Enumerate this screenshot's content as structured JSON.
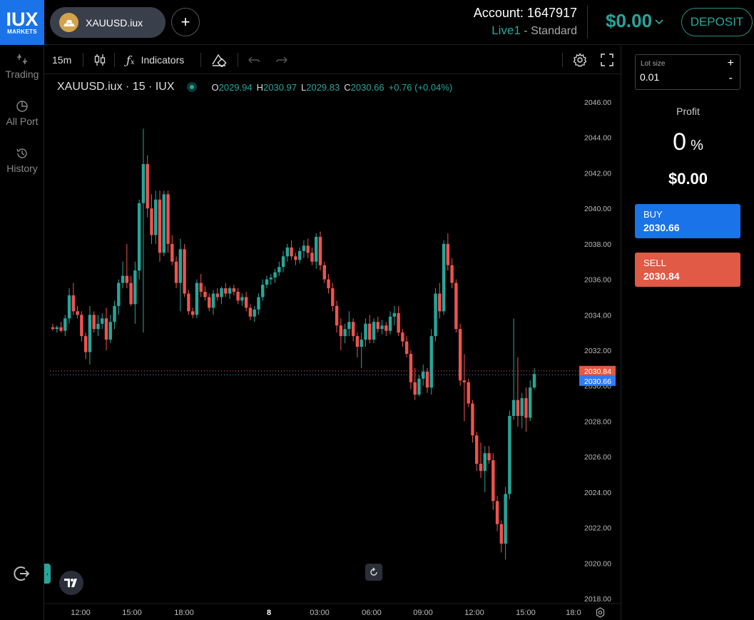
{
  "logo": {
    "main": "IUX",
    "sub": "MARKETS"
  },
  "symbol_pill": {
    "label": "XAUUSD.iux",
    "icon": "gold-bars-icon"
  },
  "add_symbol": {
    "label": "+"
  },
  "account": {
    "label": "Account:",
    "number": "1647917",
    "type": "Live1",
    "separator": " - ",
    "plan": "Standard"
  },
  "balance": {
    "value": "$0.00"
  },
  "deposit": {
    "label": "DEPOSIT"
  },
  "nav": {
    "items": [
      {
        "label": "Trading",
        "icon": "scale-icon"
      },
      {
        "label": "All Port",
        "icon": "pie-chart-icon"
      },
      {
        "label": "History",
        "icon": "history-icon"
      }
    ],
    "logout_icon": "logout-icon"
  },
  "toolbar": {
    "interval": "15m",
    "indicators": "Indicators"
  },
  "legend": {
    "title": "XAUUSD.iux · 15 · IUX",
    "o_key": "O",
    "o_val": "2029.94",
    "h_key": "H",
    "h_val": "2030.97",
    "l_key": "L",
    "l_val": "2029.83",
    "c_key": "C",
    "c_val": "2030.66",
    "change": "+0.76 (+0.04%)"
  },
  "colors": {
    "up": "#26a69a",
    "down": "#ef5350",
    "buy": "#1a73e8",
    "sell": "#e05a45"
  },
  "chart_data": {
    "type": "candlestick",
    "y_ticks": [
      "2046.00",
      "2044.00",
      "2042.00",
      "2040.00",
      "2038.00",
      "2036.00",
      "2034.00",
      "2032.00",
      "2030.00",
      "2028.00",
      "2026.00",
      "2024.00",
      "2022.00",
      "2020.00",
      "2018.00"
    ],
    "ylim": [
      2018,
      2046
    ],
    "x_ticks": [
      "12:00",
      "15:00",
      "18:00",
      "8",
      "03:00",
      "06:00",
      "09:00",
      "12:00",
      "15:00",
      "18:0"
    ],
    "ask_line": {
      "label": "2030.84",
      "value": 2030.84
    },
    "bid_line": {
      "label": "2030.66",
      "value": 2030.66
    },
    "candles": [
      [
        2033.3,
        2033.5,
        2033.1,
        2033.2
      ],
      [
        2033.2,
        2033.4,
        2033.0,
        2033.3
      ],
      [
        2033.3,
        2033.6,
        2033.0,
        2033.1
      ],
      [
        2033.1,
        2034.0,
        2032.8,
        2033.8
      ],
      [
        2033.8,
        2035.5,
        2033.5,
        2035.1
      ],
      [
        2035.1,
        2035.8,
        2034.0,
        2034.2
      ],
      [
        2034.2,
        2034.5,
        2033.8,
        2034.0
      ],
      [
        2034.0,
        2034.2,
        2032.5,
        2032.8
      ],
      [
        2032.8,
        2033.0,
        2031.5,
        2031.9
      ],
      [
        2031.9,
        2034.5,
        2031.2,
        2034.0
      ],
      [
        2034.0,
        2034.2,
        2033.0,
        2033.2
      ],
      [
        2033.2,
        2034.0,
        2032.8,
        2033.5
      ],
      [
        2033.5,
        2034.1,
        2033.2,
        2033.8
      ],
      [
        2033.8,
        2034.4,
        2032.0,
        2032.6
      ],
      [
        2032.6,
        2034.0,
        2032.4,
        2033.6
      ],
      [
        2033.6,
        2034.8,
        2033.2,
        2034.5
      ],
      [
        2034.5,
        2036.0,
        2034.0,
        2035.8
      ],
      [
        2035.8,
        2037.0,
        2035.5,
        2036.2
      ],
      [
        2036.2,
        2038.0,
        2035.5,
        2035.8
      ],
      [
        2035.8,
        2036.2,
        2034.5,
        2034.6
      ],
      [
        2034.6,
        2037.0,
        2033.5,
        2036.5
      ],
      [
        2036.5,
        2040.5,
        2036.0,
        2040.3
      ],
      [
        2040.3,
        2044.5,
        2033.0,
        2042.5
      ],
      [
        2042.5,
        2043.0,
        2039.5,
        2040.0
      ],
      [
        2040.0,
        2040.8,
        2038.0,
        2038.5
      ],
      [
        2038.5,
        2041.0,
        2038.0,
        2040.5
      ],
      [
        2040.5,
        2041.0,
        2037.0,
        2037.5
      ],
      [
        2037.5,
        2041.0,
        2037.3,
        2040.8
      ],
      [
        2040.8,
        2041.0,
        2037.5,
        2038.0
      ],
      [
        2038.0,
        2038.5,
        2036.8,
        2037.0
      ],
      [
        2037.0,
        2037.3,
        2035.5,
        2035.8
      ],
      [
        2035.8,
        2038.3,
        2034.2,
        2037.7
      ],
      [
        2037.7,
        2038.0,
        2035.0,
        2035.2
      ],
      [
        2035.2,
        2035.4,
        2034.0,
        2034.2
      ],
      [
        2034.2,
        2034.4,
        2033.8,
        2034.0
      ],
      [
        2034.0,
        2036.0,
        2033.8,
        2035.8
      ],
      [
        2035.8,
        2036.3,
        2035.0,
        2035.3
      ],
      [
        2035.3,
        2035.6,
        2034.8,
        2035.0
      ],
      [
        2035.0,
        2035.2,
        2034.2,
        2034.4
      ],
      [
        2034.4,
        2035.4,
        2034.0,
        2035.2
      ],
      [
        2035.2,
        2035.5,
        2034.8,
        2035.0
      ],
      [
        2035.0,
        2035.6,
        2034.6,
        2035.5
      ],
      [
        2035.5,
        2035.8,
        2035.0,
        2035.2
      ],
      [
        2035.2,
        2035.6,
        2034.9,
        2035.5
      ],
      [
        2035.5,
        2035.7,
        2035.1,
        2035.3
      ],
      [
        2035.3,
        2035.5,
        2034.6,
        2034.8
      ],
      [
        2034.8,
        2035.2,
        2034.5,
        2035.0
      ],
      [
        2035.0,
        2035.3,
        2034.2,
        2034.4
      ],
      [
        2034.4,
        2034.6,
        2033.7,
        2033.9
      ],
      [
        2033.9,
        2034.5,
        2033.6,
        2034.3
      ],
      [
        2034.3,
        2035.2,
        2034.0,
        2035.0
      ],
      [
        2035.0,
        2036.0,
        2034.8,
        2035.7
      ],
      [
        2035.7,
        2036.2,
        2035.5,
        2036.0
      ],
      [
        2036.0,
        2036.3,
        2035.7,
        2036.1
      ],
      [
        2036.1,
        2036.6,
        2035.8,
        2036.4
      ],
      [
        2036.4,
        2037.0,
        2036.2,
        2036.7
      ],
      [
        2036.7,
        2037.6,
        2036.4,
        2037.3
      ],
      [
        2037.3,
        2038.0,
        2037.0,
        2037.8
      ],
      [
        2037.8,
        2038.2,
        2037.1,
        2037.3
      ],
      [
        2037.3,
        2037.5,
        2036.8,
        2037.1
      ],
      [
        2037.1,
        2037.8,
        2036.9,
        2037.6
      ],
      [
        2037.6,
        2038.2,
        2037.2,
        2037.9
      ],
      [
        2037.9,
        2038.3,
        2037.2,
        2037.5
      ],
      [
        2037.5,
        2037.8,
        2036.8,
        2037.0
      ],
      [
        2037.0,
        2038.6,
        2036.6,
        2038.4
      ],
      [
        2038.4,
        2038.7,
        2036.5,
        2036.8
      ],
      [
        2036.8,
        2037.0,
        2035.8,
        2036.0
      ],
      [
        2036.0,
        2036.3,
        2035.2,
        2035.5
      ],
      [
        2035.5,
        2035.8,
        2034.2,
        2034.5
      ],
      [
        2034.5,
        2034.8,
        2033.0,
        2033.4
      ],
      [
        2033.4,
        2033.8,
        2032.0,
        2032.8
      ],
      [
        2032.8,
        2033.5,
        2032.4,
        2033.2
      ],
      [
        2033.2,
        2034.2,
        2032.8,
        2033.6
      ],
      [
        2033.6,
        2033.8,
        2032.5,
        2032.8
      ],
      [
        2032.8,
        2033.0,
        2031.6,
        2032.2
      ],
      [
        2032.2,
        2033.0,
        2031.0,
        2032.6
      ],
      [
        2032.6,
        2033.8,
        2032.2,
        2033.5
      ],
      [
        2033.5,
        2034.0,
        2032.4,
        2032.6
      ],
      [
        2032.6,
        2033.8,
        2032.4,
        2033.6
      ],
      [
        2033.6,
        2033.9,
        2033.0,
        2033.2
      ],
      [
        2033.2,
        2033.7,
        2032.9,
        2033.4
      ],
      [
        2033.4,
        2033.6,
        2032.8,
        2033.1
      ],
      [
        2033.1,
        2034.2,
        2032.9,
        2033.9
      ],
      [
        2033.9,
        2034.5,
        2033.4,
        2034.1
      ],
      [
        2034.1,
        2034.5,
        2032.8,
        2033.0
      ],
      [
        2033.0,
        2033.2,
        2032.2,
        2032.5
      ],
      [
        2032.5,
        2032.8,
        2031.6,
        2031.8
      ],
      [
        2031.8,
        2032.0,
        2029.8,
        2030.2
      ],
      [
        2030.2,
        2031.0,
        2029.2,
        2029.5
      ],
      [
        2029.5,
        2030.6,
        2029.4,
        2030.4
      ],
      [
        2030.4,
        2031.2,
        2030.0,
        2030.8
      ],
      [
        2030.8,
        2031.0,
        2029.6,
        2029.9
      ],
      [
        2029.9,
        2033.2,
        2029.5,
        2032.8
      ],
      [
        2032.8,
        2035.5,
        2032.5,
        2035.2
      ],
      [
        2035.2,
        2035.8,
        2033.8,
        2034.2
      ],
      [
        2034.2,
        2038.2,
        2034.0,
        2038.0
      ],
      [
        2038.0,
        2038.6,
        2036.5,
        2036.8
      ],
      [
        2036.8,
        2037.2,
        2035.5,
        2035.8
      ],
      [
        2035.8,
        2036.0,
        2033.0,
        2033.2
      ],
      [
        2033.2,
        2033.5,
        2030.0,
        2030.3
      ],
      [
        2030.3,
        2031.8,
        2028.0,
        2030.2
      ],
      [
        2030.2,
        2030.4,
        2028.8,
        2029.0
      ],
      [
        2029.0,
        2029.2,
        2026.8,
        2027.2
      ],
      [
        2027.2,
        2027.4,
        2025.2,
        2025.6
      ],
      [
        2025.6,
        2026.8,
        2024.8,
        2025.2
      ],
      [
        2025.2,
        2026.6,
        2024.0,
        2026.2
      ],
      [
        2026.2,
        2026.6,
        2025.6,
        2025.8
      ],
      [
        2025.8,
        2026.2,
        2023.0,
        2023.5
      ],
      [
        2023.5,
        2023.8,
        2021.8,
        2022.2
      ],
      [
        2022.2,
        2022.4,
        2020.6,
        2021.1
      ],
      [
        2021.1,
        2024.3,
        2020.2,
        2023.9
      ],
      [
        2023.9,
        2028.6,
        2023.6,
        2028.3
      ],
      [
        2028.3,
        2033.8,
        2028.1,
        2029.2
      ],
      [
        2029.2,
        2031.6,
        2027.7,
        2028.3
      ],
      [
        2028.3,
        2029.6,
        2027.6,
        2029.3
      ],
      [
        2029.3,
        2029.9,
        2027.4,
        2028.2
      ],
      [
        2028.2,
        2030.3,
        2028.0,
        2029.9
      ],
      [
        2029.9,
        2031.0,
        2029.8,
        2030.66
      ]
    ]
  }
}
